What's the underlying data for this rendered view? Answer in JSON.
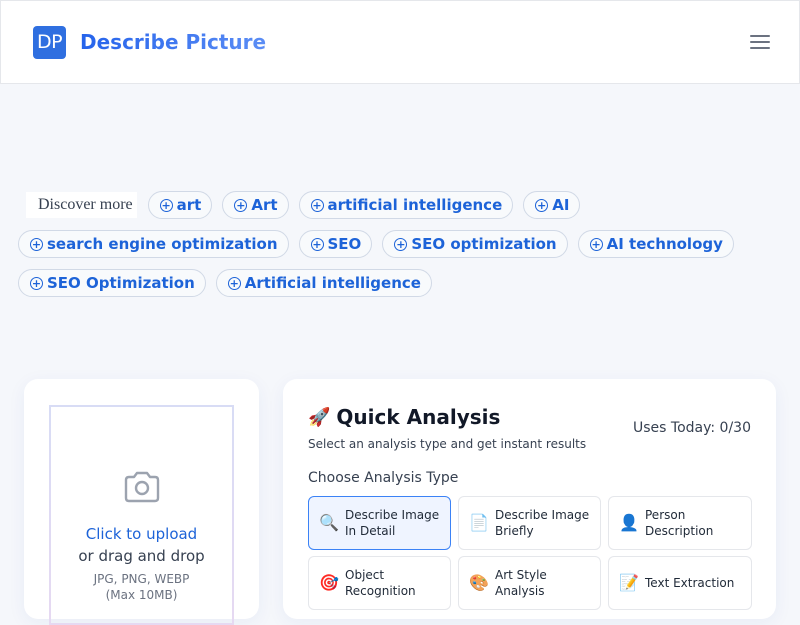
{
  "header": {
    "logo_text": "DP",
    "brand_name": "Describe Picture",
    "menu_icon": "hamburger-menu-icon"
  },
  "discover": {
    "label": "Discover more",
    "tags": [
      "art",
      "Art",
      "artificial intelligence",
      "AI",
      "search engine optimization",
      "SEO",
      "SEO optimization",
      "AI technology",
      "SEO Optimization",
      "Artificial intelligence"
    ]
  },
  "upload": {
    "icon": "camera-icon",
    "click_text": "Click to upload",
    "drag_text": "or drag and drop",
    "formats": "JPG, PNG, WEBP",
    "max_size": "(Max 10MB)"
  },
  "analysis": {
    "title_emoji": "🚀",
    "title": "Quick Analysis",
    "subtitle": "Select an analysis type and get instant results",
    "uses_today": "Uses Today: 0/30",
    "choose_label": "Choose Analysis Type",
    "options": [
      {
        "icon": "🔍",
        "icon_name": "magnifier-icon",
        "label": "Describe Image In Detail",
        "active": true
      },
      {
        "icon": "📄",
        "icon_name": "document-icon",
        "label": "Describe Image Briefly",
        "active": false
      },
      {
        "icon": "👤",
        "icon_name": "person-icon",
        "label": "Person Description",
        "active": false
      },
      {
        "icon": "🎯",
        "icon_name": "target-icon",
        "label": "Object Recognition",
        "active": false
      },
      {
        "icon": "🎨",
        "icon_name": "palette-icon",
        "label": "Art Style Analysis",
        "active": false
      },
      {
        "icon": "📝",
        "icon_name": "memo-icon",
        "label": "Text Extraction",
        "active": false
      }
    ]
  },
  "colors": {
    "accent": "#2f6fe0",
    "tag_text": "#1d63d8",
    "active_border": "#3b82f6"
  }
}
